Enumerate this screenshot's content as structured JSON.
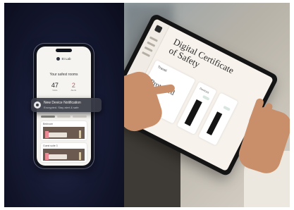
{
  "phone_app": {
    "header_brand": "Et Lab",
    "title": "Your safest rooms",
    "stats": [
      {
        "value": "47",
        "label": "Visits"
      },
      {
        "value": "2",
        "label": "Alerts"
      }
    ],
    "card_label": "Bedroom",
    "card2_label": "Guest suite 3"
  },
  "notification": {
    "title": "New Device Notification",
    "subtitle": "Encrypted. Stay alert & safe"
  },
  "tablet_app": {
    "title_line1": "Digital Certificate",
    "title_line2": "of Safety",
    "card_label": "Travel",
    "status_text": "Protected",
    "side_label": "Devices"
  },
  "colors": {
    "left_bg": "#161a33",
    "alert_red": "#c8585a",
    "accent_pink": "#e98a95",
    "tablet_paper": "#f7f2ec"
  }
}
